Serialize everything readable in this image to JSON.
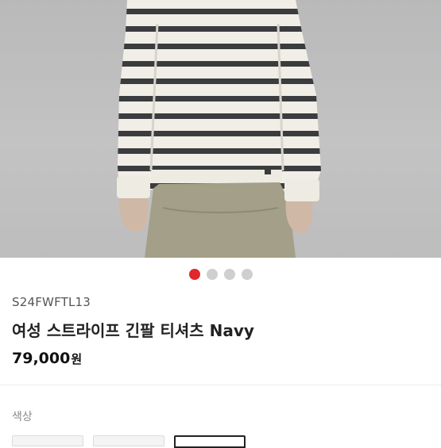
{
  "product": {
    "code": "S24FWFTL13",
    "name": "여성 스트라이프 긴팔 티셔츠 Navy",
    "price": "79,000",
    "price_unit": "원"
  },
  "gallery": {
    "total_images": 4,
    "active_index": 0,
    "accent_color": "#e0282c"
  },
  "options": {
    "color_label": "색상",
    "swatch_count": 3,
    "selected_swatch": 2
  }
}
